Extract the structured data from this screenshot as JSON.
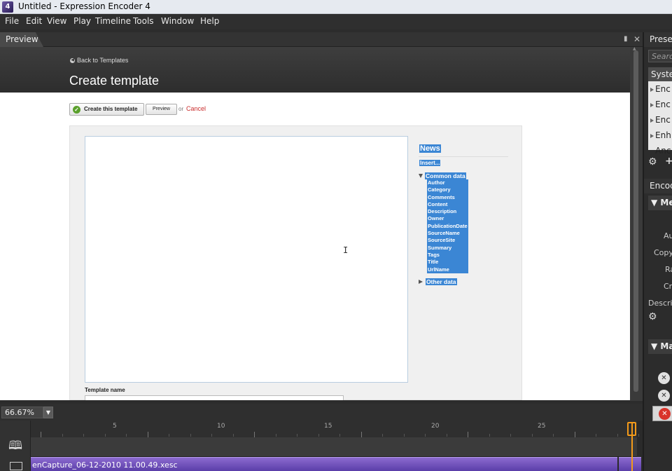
{
  "window": {
    "title": "Untitled - Expression Encoder 4",
    "app_icon_glyph": "4"
  },
  "menu": [
    "File",
    "Edit",
    "View",
    "Play",
    "Timeline",
    "Tools",
    "Window",
    "Help"
  ],
  "preview_panel": {
    "tab_label": "Preview",
    "page": {
      "back_link": "Back to Templates",
      "title": "Create template",
      "create_button": "Create this template",
      "preview_button": "Preview",
      "or_text": "or",
      "cancel_link": "Cancel",
      "template_name_label": "Template name",
      "fields_panel": {
        "title": "News",
        "insert_link": "Insert...",
        "common_group": "Common data",
        "fields": [
          "Author",
          "Category",
          "Comments",
          "Content",
          "Description",
          "Owner",
          "PublicationDate",
          "SourceName",
          "SourceSite",
          "Summary",
          "Tags",
          "Title",
          "UrlName"
        ],
        "other_group": "Other data"
      }
    }
  },
  "zoom": {
    "value": "66.67%"
  },
  "timeline": {
    "ruler_labels": [
      "5",
      "10",
      "15",
      "20",
      "25"
    ],
    "clip_name": "enCapture_06-12-2010 11.00.49.xesc"
  },
  "right_panel": {
    "header": "Preset",
    "search_placeholder": "Search",
    "system_label": "System",
    "preset_items": [
      "Enc",
      "Enc",
      "Enc",
      "Enh",
      "Anc"
    ],
    "encode_header": "Encod",
    "metadata_group": "Me",
    "metadata_labels": [
      "Au",
      "Copy",
      "Ra",
      "Cr",
      "Descrip"
    ],
    "markers_group": "Ma"
  },
  "colors": {
    "accent_purple": "#6a4bbb",
    "playhead": "#f39a1a",
    "selection_blue": "#3b86d4",
    "cancel_red": "#c92a2a"
  }
}
